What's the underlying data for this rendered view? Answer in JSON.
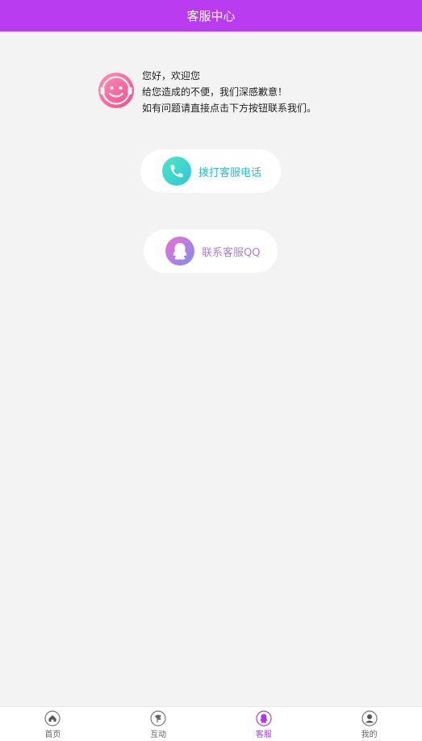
{
  "header": {
    "title": "客服中心"
  },
  "welcome": {
    "avatar_icon": "smiley-headset-icon",
    "lines": [
      "您好，欢迎您",
      "给您造成的不便，我们深感歉意！",
      "如有问题请直接点击下方按钮联系我们。"
    ]
  },
  "actions": [
    {
      "label": "拨打客服电话",
      "icon": "phone-icon",
      "color": "#2fb9c9"
    },
    {
      "label": "联系客服QQ",
      "icon": "qq-penguin-icon",
      "color": "#b07be0"
    }
  ],
  "bottom_nav": {
    "active_color": "#a83ce0",
    "items": [
      {
        "label": "首页",
        "icon": "home-icon",
        "active": false
      },
      {
        "label": "互动",
        "icon": "interaction-icon",
        "active": false
      },
      {
        "label": "客服",
        "icon": "customer-service-icon",
        "active": true
      },
      {
        "label": "我的",
        "icon": "profile-icon",
        "active": false
      }
    ]
  },
  "colors": {
    "header_bg": "#b93cf0",
    "page_bg": "#f3f3f3"
  }
}
